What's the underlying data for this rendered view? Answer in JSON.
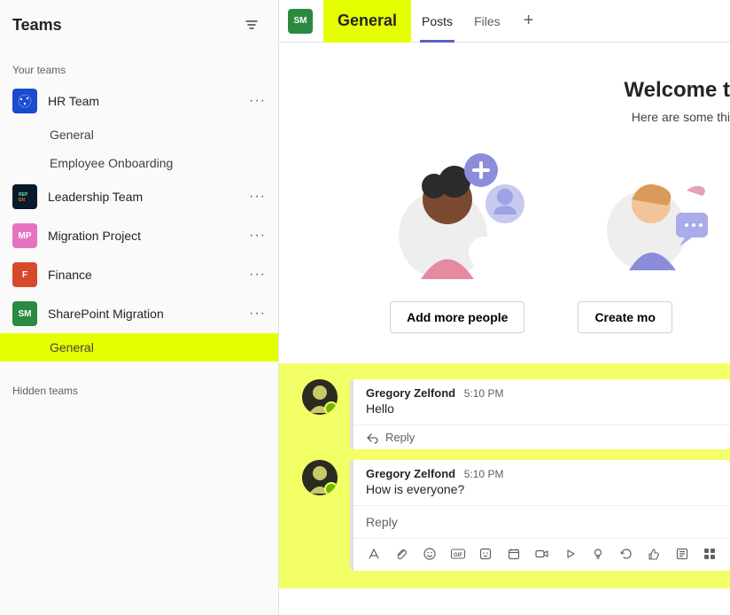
{
  "sidebar": {
    "title": "Teams",
    "section_your": "Your teams",
    "section_hidden": "Hidden teams",
    "teams": [
      {
        "name": "HR Team",
        "color": "#1a4bd1",
        "abbr": "",
        "channels": [
          "General",
          "Employee Onboarding"
        ]
      },
      {
        "name": "Leadership Team",
        "color": "#0b1a2a",
        "abbr": ""
      },
      {
        "name": "Migration Project",
        "color": "#e673c1",
        "abbr": "MP"
      },
      {
        "name": "Finance",
        "color": "#d64a2b",
        "abbr": "F"
      },
      {
        "name": "SharePoint Migration",
        "color": "#2a8a3f",
        "abbr": "SM",
        "channels": [
          "General"
        ],
        "selected": true
      }
    ]
  },
  "header": {
    "team_abbr": "SM",
    "channel": "General",
    "tabs": [
      "Posts",
      "Files"
    ],
    "active_tab": "Posts"
  },
  "welcome": {
    "title": "Welcome t",
    "subtitle": "Here are some thi",
    "btn_add_people": "Add more people",
    "btn_create_channels": "Create mo"
  },
  "messages": [
    {
      "author": "Gregory Zelfond",
      "time": "5:10 PM",
      "text": "Hello",
      "reply_label": "Reply"
    },
    {
      "author": "Gregory Zelfond",
      "time": "5:10 PM",
      "text": "How is everyone?",
      "reply_placeholder": "Reply"
    }
  ],
  "compose_icons": [
    "format-icon",
    "attach-icon",
    "emoji-icon",
    "gif-icon",
    "sticker-icon",
    "schedule-icon",
    "meet-icon",
    "stream-icon",
    "bulb-icon",
    "approvals-icon",
    "praise-icon",
    "viva-icon",
    "more-apps-icon"
  ]
}
